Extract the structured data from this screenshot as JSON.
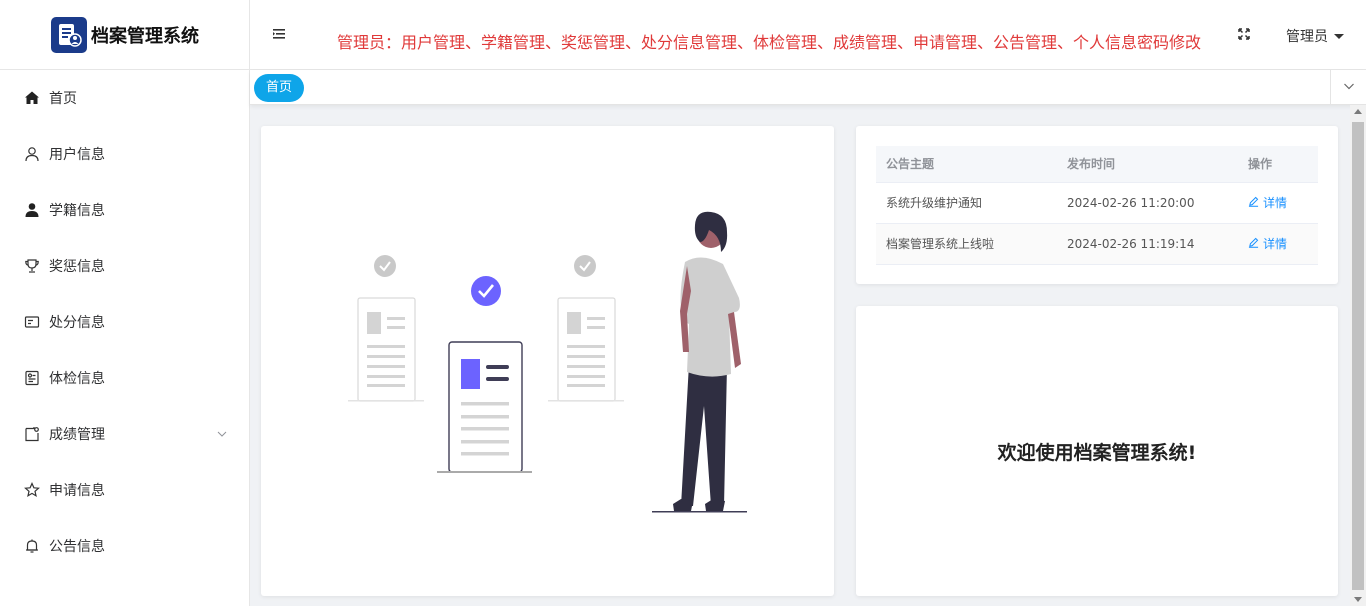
{
  "header": {
    "logo_icon": "archive-user-icon",
    "title": "档案管理系统",
    "marquee": "管理员：用户管理、学籍管理、奖惩管理、处分信息管理、体检管理、成绩管理、申请管理、公告管理、个人信息密码修改",
    "user_label": "管理员",
    "accent_color": "#e03a3a"
  },
  "sidebar": {
    "items": [
      {
        "label": "首页",
        "icon": "home-icon"
      },
      {
        "label": "用户信息",
        "icon": "user-icon"
      },
      {
        "label": "学籍信息",
        "icon": "person-filled-icon"
      },
      {
        "label": "奖惩信息",
        "icon": "trophy-icon"
      },
      {
        "label": "处分信息",
        "icon": "card-icon"
      },
      {
        "label": "体检信息",
        "icon": "checkup-icon"
      },
      {
        "label": "成绩管理",
        "icon": "document-icon"
      },
      {
        "label": "申请信息",
        "icon": "star-icon"
      },
      {
        "label": "公告信息",
        "icon": "bell-icon"
      }
    ]
  },
  "tabs": [
    {
      "label": "首页"
    }
  ],
  "notices": {
    "columns": [
      "公告主题",
      "发布时间",
      "操作"
    ],
    "rows": [
      {
        "title": "系统升级维护通知",
        "time": "2024-02-26 11:20:00",
        "action": "详情"
      },
      {
        "title": "档案管理系统上线啦",
        "time": "2024-02-26 11:19:14",
        "action": "详情"
      }
    ]
  },
  "welcome": {
    "text": "欢迎使用档案管理系统!"
  },
  "colors": {
    "tab_active": "#0ea5e9",
    "link": "#1890ff",
    "logo_bg": "#1b3b8a"
  }
}
